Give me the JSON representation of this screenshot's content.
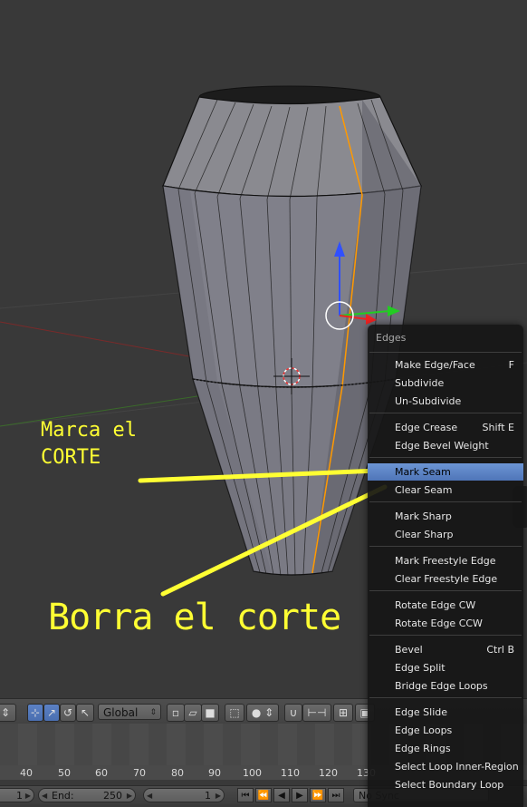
{
  "annotations": {
    "marca": "Marca el\nCORTE",
    "borra": "Borra el corte"
  },
  "header": {
    "orientation": "Global"
  },
  "timeline": {
    "ticks": [
      "40",
      "50",
      "60",
      "70",
      "80",
      "90",
      "100",
      "110",
      "120",
      "130"
    ],
    "start_value": "1",
    "end_label": "End:",
    "end_value": "250",
    "current_frame": "1",
    "sync": "No Sync"
  },
  "menu": {
    "title": "Edges",
    "items": [
      {
        "label": "Make Edge/Face",
        "shortcut": "F"
      },
      {
        "label": "Subdivide",
        "shortcut": ""
      },
      {
        "label": "Un-Subdivide",
        "shortcut": ""
      },
      {
        "label": "Edge Crease",
        "shortcut": "Shift E"
      },
      {
        "label": "Edge Bevel Weight",
        "shortcut": ""
      },
      {
        "label": "Mark Seam",
        "shortcut": ""
      },
      {
        "label": "Clear Seam",
        "shortcut": ""
      },
      {
        "label": "Mark Sharp",
        "shortcut": ""
      },
      {
        "label": "Clear Sharp",
        "shortcut": ""
      },
      {
        "label": "Mark Freestyle Edge",
        "shortcut": ""
      },
      {
        "label": "Clear Freestyle Edge",
        "shortcut": ""
      },
      {
        "label": "Rotate Edge CW",
        "shortcut": ""
      },
      {
        "label": "Rotate Edge CCW",
        "shortcut": ""
      },
      {
        "label": "Bevel",
        "shortcut": "Ctrl B"
      },
      {
        "label": "Edge Split",
        "shortcut": ""
      },
      {
        "label": "Bridge Edge Loops",
        "shortcut": ""
      },
      {
        "label": "Edge Slide",
        "shortcut": ""
      },
      {
        "label": "Edge Loops",
        "shortcut": ""
      },
      {
        "label": "Edge Rings",
        "shortcut": ""
      },
      {
        "label": "Select Loop Inner-Region",
        "shortcut": ""
      },
      {
        "label": "Select Boundary Loop",
        "shortcut": ""
      }
    ],
    "highlighted": "Mark Seam"
  },
  "colors": {
    "annotation": "#ffff33",
    "seam": "#ff9900",
    "highlight": "#5b84c8"
  }
}
